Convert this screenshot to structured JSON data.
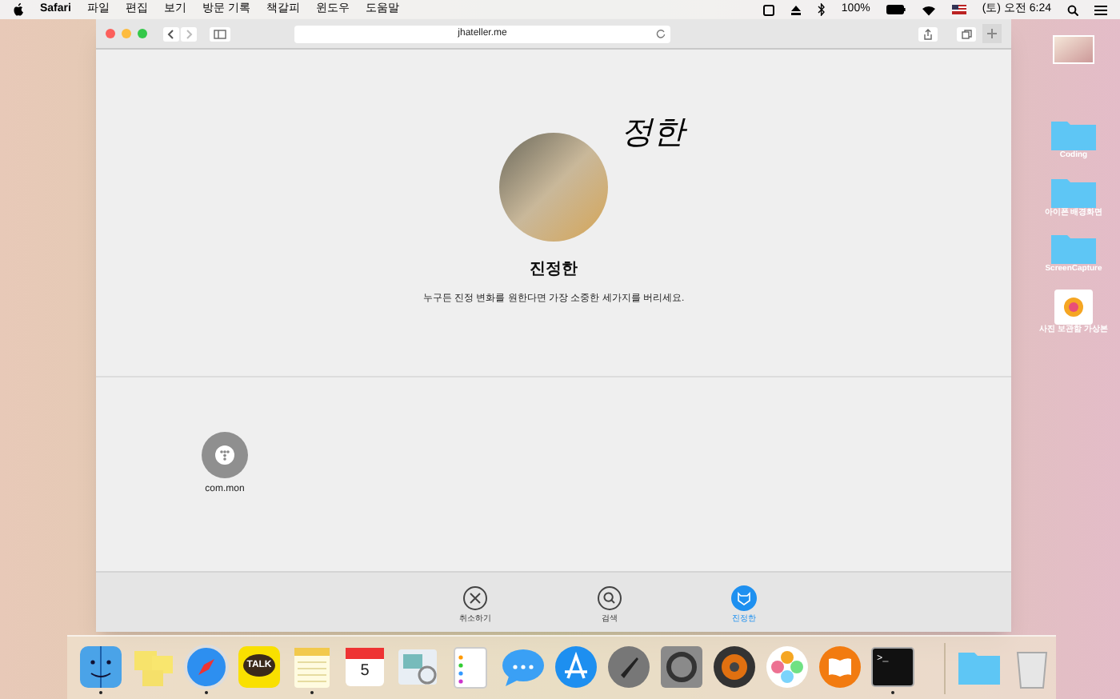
{
  "menu_bar": {
    "app": "Safari",
    "items": [
      "파일",
      "편집",
      "보기",
      "방문 기록",
      "책갈피",
      "윈도우",
      "도움말"
    ],
    "battery": "100%",
    "clock": "(토) 오전 6:24"
  },
  "browser": {
    "address": "jhateller.me"
  },
  "profile": {
    "signature": "정한",
    "name": "진정한",
    "bio": "누구든 진정 변화를 원한다면 가장 소중한 세가지를 버리세요."
  },
  "apps": [
    {
      "label": "com.mon"
    }
  ],
  "tabs": [
    {
      "kind": "close",
      "label": "취소하기",
      "selected": false
    },
    {
      "kind": "search",
      "label": "검색",
      "selected": false
    },
    {
      "kind": "profile",
      "label": "진정한",
      "selected": true
    }
  ],
  "desktop_icons": [
    {
      "kind": "folder",
      "label": "Coding"
    },
    {
      "kind": "folder",
      "label": "아이폰 배경화면"
    },
    {
      "kind": "folder",
      "label": "ScreenCapture"
    },
    {
      "kind": "photos",
      "label": "사진 보관함 가상본"
    }
  ],
  "dock": [
    {
      "kind": "finder",
      "running": true
    },
    {
      "kind": "stickies",
      "running": false
    },
    {
      "kind": "safari",
      "running": true
    },
    {
      "kind": "talk",
      "text": "TALK",
      "running": false
    },
    {
      "kind": "notes",
      "running": true
    },
    {
      "kind": "calendar",
      "text": "5",
      "running": false
    },
    {
      "kind": "preview",
      "running": false
    },
    {
      "kind": "reminders",
      "running": false
    },
    {
      "kind": "messages",
      "running": false
    },
    {
      "kind": "appstore",
      "running": false
    },
    {
      "kind": "launchpad",
      "running": false
    },
    {
      "kind": "settings",
      "running": false
    },
    {
      "kind": "speaker",
      "running": false
    },
    {
      "kind": "photos",
      "running": false
    },
    {
      "kind": "books",
      "running": false
    },
    {
      "kind": "terminal",
      "text": ">_",
      "running": true
    },
    {
      "kind": "folder",
      "running": false
    },
    {
      "kind": "trash",
      "running": false
    }
  ]
}
